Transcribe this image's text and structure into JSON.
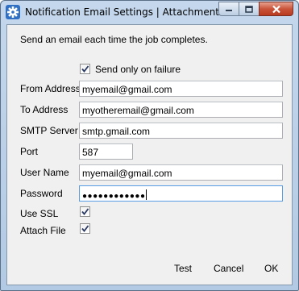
{
  "window": {
    "title": "Notification Email Settings | Attachments"
  },
  "intro_text": "Send an email each time the job completes.",
  "send_only_on_failure": {
    "label": "Send only on failure",
    "checked": true
  },
  "fields": {
    "from_address": {
      "label": "From Address",
      "value": "myemail@gmail.com"
    },
    "to_address": {
      "label": "To Address",
      "value": "myotheremail@gmail.com"
    },
    "smtp_server": {
      "label": "SMTP Server",
      "value": "smtp.gmail.com"
    },
    "port": {
      "label": "Port",
      "value": "587"
    },
    "user_name": {
      "label": "User Name",
      "value": "myemail@gmail.com"
    },
    "password": {
      "label": "Password",
      "value": "●●●●●●●●●●●●"
    }
  },
  "use_ssl": {
    "label": "Use SSL",
    "checked": true
  },
  "attach_file": {
    "label": "Attach File",
    "checked": true
  },
  "buttons": {
    "test": "Test",
    "cancel": "Cancel",
    "ok": "OK"
  },
  "colors": {
    "title_bar": "#c4d7ec",
    "close_button": "#c9543a",
    "focus_border": "#569de5"
  }
}
